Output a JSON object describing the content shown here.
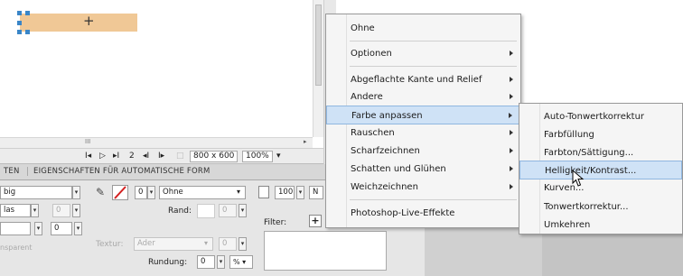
{
  "canvas": {
    "crosshair": "+"
  },
  "status": {
    "first_icon": "I◂",
    "play_icon": "▷",
    "last_icon": "▸I",
    "frame": "2",
    "prev_icon": "◂I",
    "next_icon": "I▸",
    "size": "800 x 600",
    "zoom": "100%",
    "grip": "III"
  },
  "tabs": {
    "left": "TEN",
    "right": "EIGENSCHAFTEN FÜR AUTOMATISCHE FORM"
  },
  "props": {
    "row1_field": "big",
    "row2_field": "las",
    "row2_value": "0",
    "row3_value": "0",
    "transparent": "nsparent",
    "stroke_value": "0",
    "stroke_style": "Ohne",
    "edge_label": "Rand:",
    "edge_value": "0",
    "texture_label": "Textur:",
    "texture_value": "Ader",
    "texture_amount": "0",
    "rounding_label": "Rundung:",
    "rounding_value": "0",
    "rounding_unit": "% ▾",
    "opacity_value": "100",
    "blend": "N",
    "filter_label": "Filter:",
    "filter_add": "+"
  },
  "menu": {
    "items": [
      {
        "label": "Ohne"
      },
      {
        "label": "Optionen"
      },
      {
        "label": "Abgeflachte Kante und Relief"
      },
      {
        "label": "Andere"
      },
      {
        "label": "Farbe anpassen"
      },
      {
        "label": "Rauschen"
      },
      {
        "label": "Scharfzeichnen"
      },
      {
        "label": "Schatten und Glühen"
      },
      {
        "label": "Weichzeichnen"
      },
      {
        "label": "Photoshop-Live-Effekte"
      }
    ]
  },
  "submenu": {
    "items": [
      {
        "label": "Auto-Tonwertkorrektur"
      },
      {
        "label": "Farbfüllung"
      },
      {
        "label": "Farbton/Sättigung..."
      },
      {
        "label": "Helligkeit/Kontrast..."
      },
      {
        "label": "Kurven..."
      },
      {
        "label": "Tonwertkorrektur..."
      },
      {
        "label": "Umkehren"
      }
    ]
  }
}
